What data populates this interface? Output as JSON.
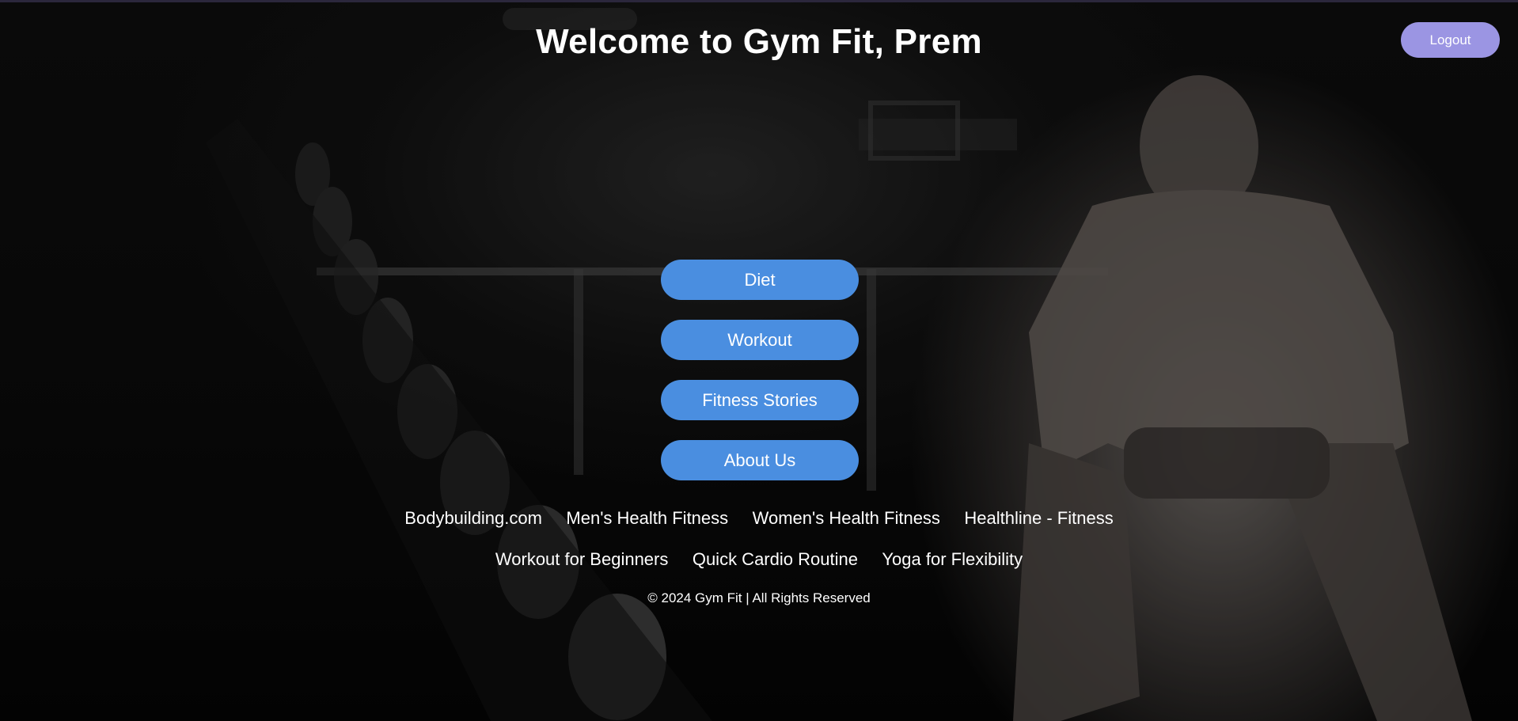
{
  "header": {
    "title": "Welcome to Gym Fit, Prem",
    "logout_label": "Logout"
  },
  "menu": {
    "items": [
      {
        "label": "Diet"
      },
      {
        "label": "Workout"
      },
      {
        "label": "Fitness Stories"
      },
      {
        "label": "About Us"
      }
    ]
  },
  "links": {
    "row1": [
      {
        "label": "Bodybuilding.com"
      },
      {
        "label": "Men's Health Fitness"
      },
      {
        "label": "Women's Health Fitness"
      },
      {
        "label": "Healthline - Fitness"
      }
    ],
    "row2": [
      {
        "label": "Workout for Beginners"
      },
      {
        "label": "Quick Cardio Routine"
      },
      {
        "label": "Yoga for Flexibility"
      }
    ]
  },
  "footer": {
    "text": "© 2024 Gym Fit | All Rights Reserved"
  },
  "colors": {
    "menu_button": "#4a8ee0",
    "logout_button": "#9b95e3",
    "text": "#ffffff"
  }
}
